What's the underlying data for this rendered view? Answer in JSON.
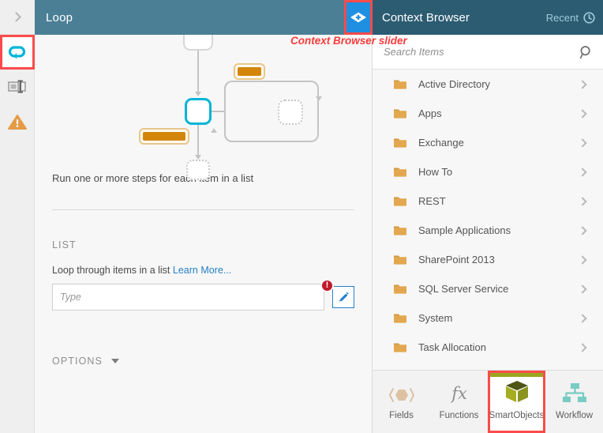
{
  "left_rail": {
    "collapse_icon": "chevron-right-icon",
    "items": [
      {
        "id": "loop",
        "icon": "loop-icon",
        "active": true
      },
      {
        "id": "properties",
        "icon": "properties-panel-icon",
        "active": false
      },
      {
        "id": "warnings",
        "icon": "warning-triangle-icon",
        "active": false
      }
    ]
  },
  "main": {
    "title": "Loop",
    "slider_button": {
      "icon": "context-browser-slider-icon"
    },
    "description": "Run one or more steps for each item in a list",
    "section_label": "LIST",
    "field_label": "Loop through items in a list",
    "learn_more": "Learn More...",
    "input_placeholder": "Type",
    "input_value": "",
    "error_badge": "!",
    "edit_icon": "pencil-icon",
    "options_label": "OPTIONS"
  },
  "annotation": {
    "text": "Context Browser slider",
    "color": "#fb3b3b"
  },
  "context_browser": {
    "title": "Context Browser",
    "recent_label": "Recent",
    "recent_icon": "clock-icon",
    "search_placeholder": "Search Items",
    "search_value": "",
    "search_icon": "search-icon",
    "folders": [
      {
        "name": "Active Directory",
        "icon": "folder-icon",
        "chevron": "chevron-right-icon"
      },
      {
        "name": "Apps",
        "icon": "folder-icon",
        "chevron": "chevron-right-icon"
      },
      {
        "name": "Exchange",
        "icon": "folder-icon",
        "chevron": "chevron-right-icon"
      },
      {
        "name": "How To",
        "icon": "folder-icon",
        "chevron": "chevron-right-icon"
      },
      {
        "name": "REST",
        "icon": "folder-icon",
        "chevron": "chevron-right-icon"
      },
      {
        "name": "Sample Applications",
        "icon": "folder-icon",
        "chevron": "chevron-right-icon"
      },
      {
        "name": "SharePoint 2013",
        "icon": "folder-icon",
        "chevron": "chevron-right-icon"
      },
      {
        "name": "SQL Server Service",
        "icon": "folder-icon",
        "chevron": "chevron-right-icon"
      },
      {
        "name": "System",
        "icon": "folder-icon",
        "chevron": "chevron-right-icon"
      },
      {
        "name": "Task Allocation",
        "icon": "folder-icon",
        "chevron": "chevron-right-icon"
      }
    ],
    "tabs": [
      {
        "label": "Fields",
        "icon": "fields-icon",
        "selected": false
      },
      {
        "label": "Functions",
        "icon": "functions-fx-icon",
        "selected": false
      },
      {
        "label": "SmartObjects",
        "icon": "smartobjects-cube-icon",
        "selected": true
      },
      {
        "label": "Workflow",
        "icon": "workflow-hierarchy-icon",
        "selected": false
      }
    ]
  },
  "colors": {
    "header_blue": "#4b7f96",
    "cb_header_blue": "#2c5c72",
    "slider_blue": "#1e8fe1",
    "annotation_red": "#fb3b3b",
    "highlight_red": "#fb4b4b",
    "selected_node_cyan": "#00b5d6",
    "tag_orange": "#d4860b",
    "folder_orange": "#e3a84f",
    "error_red": "#c0182b",
    "link_blue": "#2580c3",
    "smartobject_green": "#9aa61e",
    "workflow_teal": "#79ccc4"
  }
}
